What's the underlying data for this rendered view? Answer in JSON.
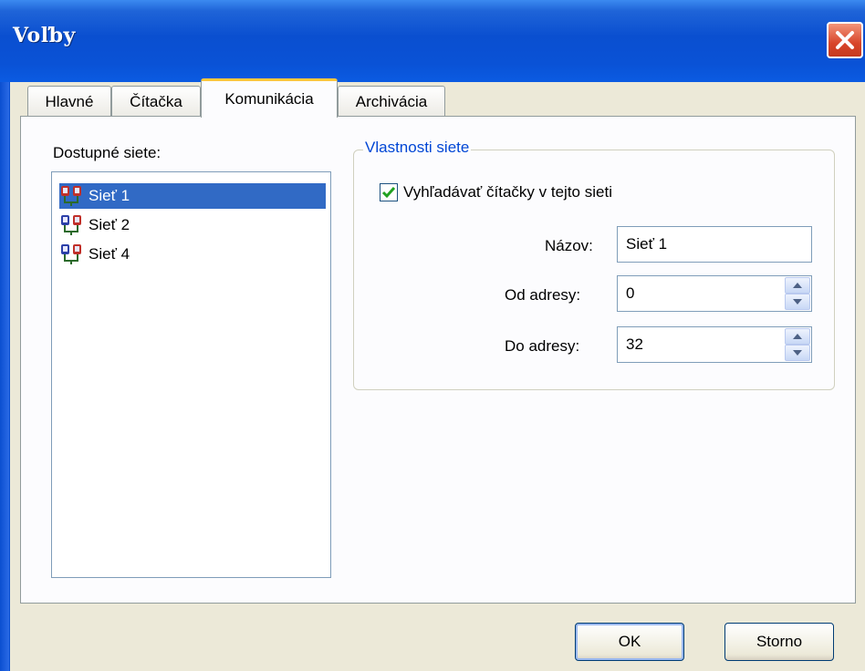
{
  "window": {
    "title": "Voľby"
  },
  "tabs": [
    {
      "label": "Hlavné"
    },
    {
      "label": "Čítačka"
    },
    {
      "label": "Komunikácia",
      "active": true
    },
    {
      "label": "Archivácia"
    }
  ],
  "networks": {
    "label": "Dostupné siete:",
    "items": [
      {
        "label": "Sieť 1",
        "selected": true,
        "icon": "network-icon"
      },
      {
        "label": "Sieť 2",
        "selected": false,
        "icon": "network-icon"
      },
      {
        "label": "Sieť 4",
        "selected": false,
        "icon": "network-icon"
      }
    ]
  },
  "properties": {
    "title": "Vlastnosti siete",
    "search_checkbox": {
      "label": "Vyhľadávať čítačky v tejto sieti",
      "checked": true
    },
    "name": {
      "label": "Názov:",
      "value": "Sieť 1"
    },
    "from_address": {
      "label": "Od adresy:",
      "value": "0"
    },
    "to_address": {
      "label": "Do adresy:",
      "value": "32"
    }
  },
  "buttons": {
    "ok": "OK",
    "cancel": "Storno"
  },
  "colors": {
    "titlebar": "#0a52d6",
    "selection": "#316ac5",
    "group_title": "#0046d5",
    "active_tab_accent": "#ffc73c"
  }
}
